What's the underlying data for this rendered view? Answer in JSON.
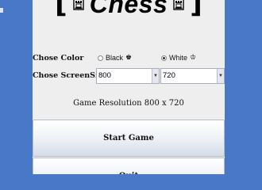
{
  "header": {
    "title": "Chess",
    "left_bracket": "[",
    "right_bracket": "]",
    "icon": "rook-icon"
  },
  "color_row": {
    "label": "Chose Color",
    "options": [
      {
        "label": "Black",
        "piece_glyph": "♚",
        "selected": false
      },
      {
        "label": "White",
        "piece_glyph": "♔",
        "selected": true
      }
    ]
  },
  "screen_size_row": {
    "label": "Chose ScreenSize",
    "width_value": "800",
    "height_value": "720"
  },
  "resolution_text": "Game Resolution 800 x 720",
  "buttons": {
    "start_label": "Start Game",
    "quit_label": "Quit"
  },
  "colors": {
    "background": "#4a78c8",
    "panel": "#eeeeee"
  }
}
